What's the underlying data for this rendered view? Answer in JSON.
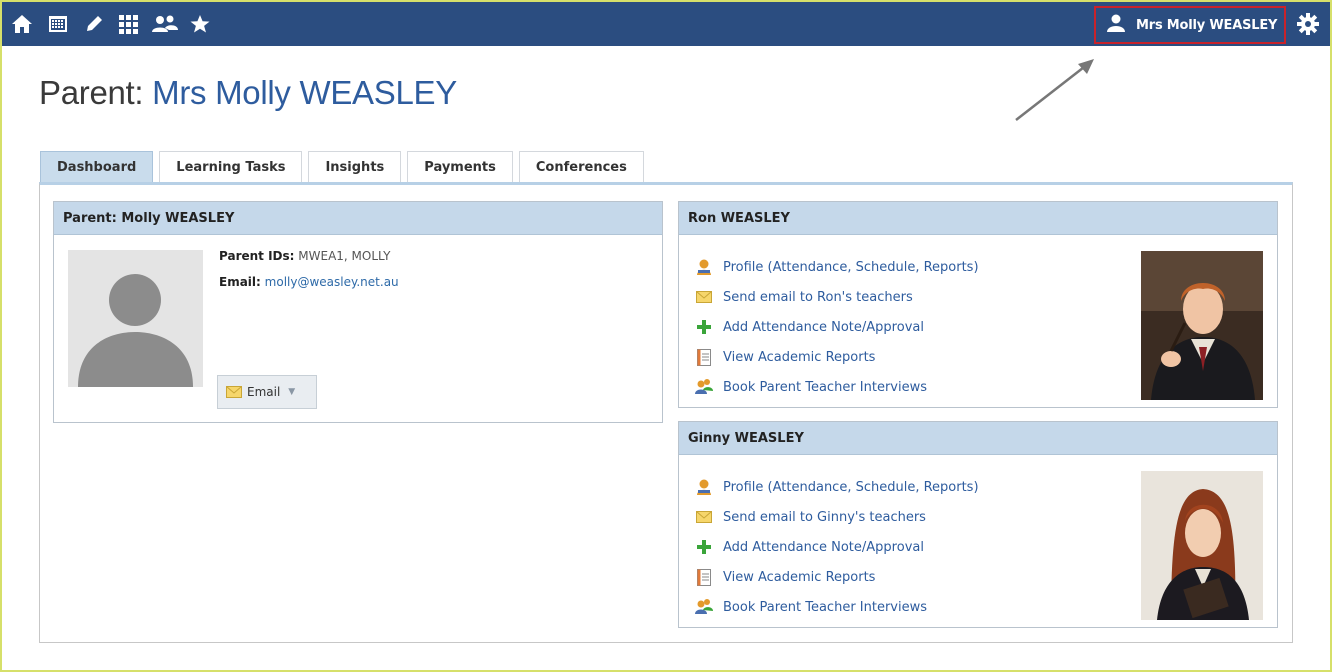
{
  "nav": {
    "icons": [
      "home-icon",
      "calendar-icon",
      "pencil-icon",
      "grid-icon",
      "people-icon",
      "star-icon"
    ],
    "user_name": "Mrs Molly WEASLEY",
    "bar_color": "#2b4d80",
    "highlight_color": "#c8222a"
  },
  "page": {
    "title_prefix": "Parent: ",
    "title_name": "Mrs Molly WEASLEY"
  },
  "tabs": [
    {
      "label": "Dashboard",
      "active": true
    },
    {
      "label": "Learning Tasks",
      "active": false
    },
    {
      "label": "Insights",
      "active": false
    },
    {
      "label": "Payments",
      "active": false
    },
    {
      "label": "Conferences",
      "active": false
    }
  ],
  "parent_card": {
    "header": "Parent: Molly WEASLEY",
    "ids_label": "Parent IDs:",
    "ids_value": "MWEA1, MOLLY",
    "email_label": "Email:",
    "email_value": "molly@weasley.net.au",
    "email_button": "Email"
  },
  "children": [
    {
      "header": "Ron WEASLEY",
      "links": [
        "Profile (Attendance, Schedule, Reports)",
        "Send email to Ron's teachers",
        "Add Attendance Note/Approval",
        "View Academic Reports",
        "Book Parent Teacher Interviews"
      ]
    },
    {
      "header": "Ginny WEASLEY",
      "links": [
        "Profile (Attendance, Schedule, Reports)",
        "Send email to Ginny's teachers",
        "Add Attendance Note/Approval",
        "View Academic Reports",
        "Book Parent Teacher Interviews"
      ]
    }
  ]
}
